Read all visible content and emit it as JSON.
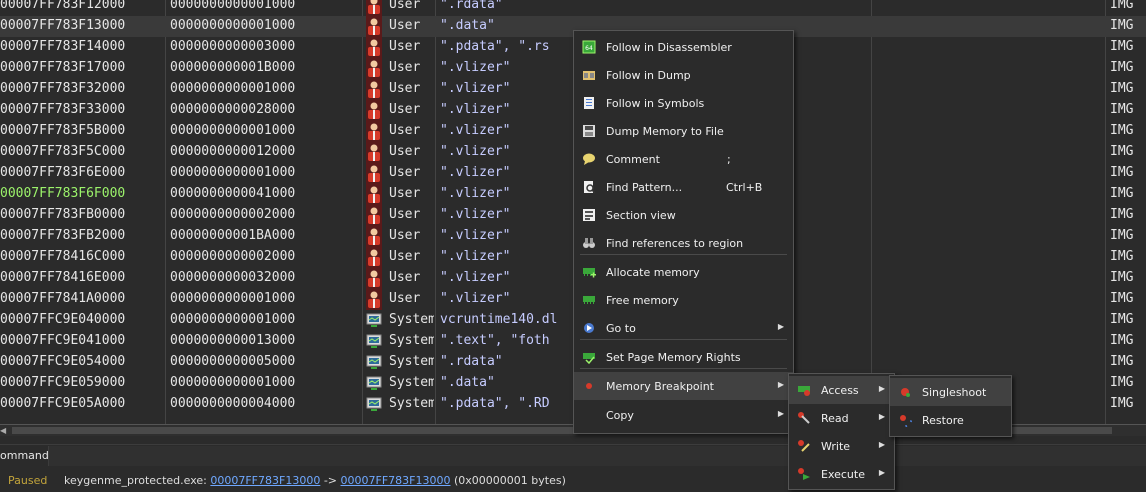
{
  "rows": [
    {
      "addr": "00007FF783F12000",
      "size": "0000000000001000",
      "type": "User",
      "info": "\".rdata\"",
      "prot": "IMG",
      "icon": "user-icon",
      "addr_color": "#e6e6e6",
      "selected": false
    },
    {
      "addr": "00007FF783F13000",
      "size": "0000000000001000",
      "type": "User",
      "info": "\".data\"",
      "prot": "IMG",
      "icon": "user-icon",
      "addr_color": "#e6e6e6",
      "selected": true
    },
    {
      "addr": "00007FF783F14000",
      "size": "0000000000003000",
      "type": "User",
      "info": "\".pdata\", \".rs",
      "prot": "IMG",
      "icon": "user-icon",
      "addr_color": "#e6e6e6",
      "selected": false
    },
    {
      "addr": "00007FF783F17000",
      "size": "000000000001B000",
      "type": "User",
      "info": "\".vlizer\"",
      "prot": "IMG",
      "icon": "user-icon",
      "addr_color": "#e6e6e6",
      "selected": false
    },
    {
      "addr": "00007FF783F32000",
      "size": "0000000000001000",
      "type": "User",
      "info": "\".vlizer\"",
      "prot": "IMG",
      "icon": "user-icon",
      "addr_color": "#e6e6e6",
      "selected": false
    },
    {
      "addr": "00007FF783F33000",
      "size": "0000000000028000",
      "type": "User",
      "info": "\".vlizer\"",
      "prot": "IMG",
      "icon": "user-icon",
      "addr_color": "#e6e6e6",
      "selected": false
    },
    {
      "addr": "00007FF783F5B000",
      "size": "0000000000001000",
      "type": "User",
      "info": "\".vlizer\"",
      "prot": "IMG",
      "icon": "user-icon",
      "addr_color": "#e6e6e6",
      "selected": false
    },
    {
      "addr": "00007FF783F5C000",
      "size": "0000000000012000",
      "type": "User",
      "info": "\".vlizer\"",
      "prot": "IMG",
      "icon": "user-icon",
      "addr_color": "#e6e6e6",
      "selected": false
    },
    {
      "addr": "00007FF783F6E000",
      "size": "0000000000001000",
      "type": "User",
      "info": "\".vlizer\"",
      "prot": "IMG",
      "icon": "user-icon",
      "addr_color": "#e6e6e6",
      "selected": false
    },
    {
      "addr": "00007FF783F6F000",
      "size": "0000000000041000",
      "type": "User",
      "info": "\".vlizer\"",
      "prot": "IMG",
      "icon": "user-icon",
      "addr_color": "#9cf36b",
      "selected": false
    },
    {
      "addr": "00007FF783FB0000",
      "size": "0000000000002000",
      "type": "User",
      "info": "\".vlizer\"",
      "prot": "IMG",
      "icon": "user-icon",
      "addr_color": "#e6e6e6",
      "selected": false
    },
    {
      "addr": "00007FF783FB2000",
      "size": "00000000001BA000",
      "type": "User",
      "info": "\".vlizer\"",
      "prot": "IMG",
      "icon": "user-icon",
      "addr_color": "#e6e6e6",
      "selected": false
    },
    {
      "addr": "00007FF78416C000",
      "size": "0000000000002000",
      "type": "User",
      "info": "\".vlizer\"",
      "prot": "IMG",
      "icon": "user-icon",
      "addr_color": "#e6e6e6",
      "selected": false
    },
    {
      "addr": "00007FF78416E000",
      "size": "0000000000032000",
      "type": "User",
      "info": "\".vlizer\"",
      "prot": "IMG",
      "icon": "user-icon",
      "addr_color": "#e6e6e6",
      "selected": false
    },
    {
      "addr": "00007FF7841A0000",
      "size": "0000000000001000",
      "type": "User",
      "info": "\".vlizer\"",
      "prot": "IMG",
      "icon": "user-icon",
      "addr_color": "#e6e6e6",
      "selected": false
    },
    {
      "addr": "00007FFC9E040000",
      "size": "0000000000001000",
      "type": "System",
      "info": "vcruntime140.dl",
      "prot": "IMG",
      "icon": "system-icon",
      "addr_color": "#e6e6e6",
      "selected": false
    },
    {
      "addr": "00007FFC9E041000",
      "size": "0000000000013000",
      "type": "System",
      "info": "\".text\", \"foth",
      "prot": "IMG",
      "icon": "system-icon",
      "addr_color": "#e6e6e6",
      "selected": false
    },
    {
      "addr": "00007FFC9E054000",
      "size": "0000000000005000",
      "type": "System",
      "info": "\".rdata\"",
      "prot": "IMG",
      "icon": "system-icon",
      "addr_color": "#e6e6e6",
      "selected": false
    },
    {
      "addr": "00007FFC9E059000",
      "size": "0000000000001000",
      "type": "System",
      "info": "\".data\"",
      "prot": "IMG",
      "icon": "system-icon",
      "addr_color": "#e6e6e6",
      "selected": false
    },
    {
      "addr": "00007FFC9E05A000",
      "size": "0000000000004000",
      "type": "System",
      "info": "\".pdata\", \".RD",
      "prot": "IMG",
      "icon": "system-icon",
      "addr_color": "#e6e6e6",
      "selected": false
    }
  ],
  "context_menu": [
    {
      "label": "Follow in Disassembler",
      "shortcut": "",
      "icon": "cpu-icon",
      "submenu": false,
      "highlight": false
    },
    {
      "label": "Follow in Dump",
      "shortcut": "",
      "icon": "dump-icon",
      "submenu": false,
      "highlight": false
    },
    {
      "label": "Follow in Symbols",
      "shortcut": "",
      "icon": "symbols-icon",
      "submenu": false,
      "highlight": false
    },
    {
      "label": "Dump Memory to File",
      "shortcut": "",
      "icon": "save-memory-icon",
      "submenu": false,
      "highlight": false
    },
    {
      "label": "Comment",
      "shortcut": ";",
      "icon": "comment-icon",
      "submenu": false,
      "highlight": false
    },
    {
      "label": "Find Pattern...",
      "shortcut": "Ctrl+B",
      "icon": "find-pattern-icon",
      "submenu": false,
      "highlight": false
    },
    {
      "label": "Section view",
      "shortcut": "",
      "icon": "section-view-icon",
      "submenu": false,
      "highlight": false
    },
    {
      "label": "Find references to region",
      "shortcut": "",
      "icon": "binoculars-icon",
      "submenu": false,
      "highlight": false
    },
    {
      "label": "Allocate memory",
      "shortcut": "",
      "icon": "allocate-memory-icon",
      "submenu": false,
      "highlight": false
    },
    {
      "label": "Free memory",
      "shortcut": "",
      "icon": "free-memory-icon",
      "submenu": false,
      "highlight": false
    },
    {
      "label": "Go to",
      "shortcut": "",
      "icon": "goto-icon",
      "submenu": true,
      "highlight": false
    },
    {
      "label": "Set Page Memory Rights",
      "shortcut": "",
      "icon": "memory-rights-icon",
      "submenu": false,
      "highlight": false
    },
    {
      "label": "Memory Breakpoint",
      "shortcut": "",
      "icon": "breakpoint-dot-icon",
      "submenu": true,
      "highlight": true
    },
    {
      "label": "Copy",
      "shortcut": "",
      "icon": "",
      "submenu": true,
      "highlight": false
    }
  ],
  "breakpoint_menu": [
    {
      "label": "Access",
      "icon": "access-icon",
      "highlight": true
    },
    {
      "label": "Read",
      "icon": "read-icon",
      "highlight": false
    },
    {
      "label": "Write",
      "icon": "write-icon",
      "highlight": false
    },
    {
      "label": "Execute",
      "icon": "execute-icon",
      "highlight": false
    }
  ],
  "access_menu": [
    {
      "label": "Singleshoot",
      "icon": "singleshoot-icon",
      "highlight": true
    },
    {
      "label": "Restore",
      "icon": "restore-icon",
      "highlight": false
    }
  ],
  "command": {
    "label": "ommand:",
    "value": ""
  },
  "status": {
    "state": "Paused",
    "message_prefix": "keygenme_protected.exe: ",
    "addr_from": "00007FF783F13000",
    "arrow": " -> ",
    "addr_to": "00007FF783F13000",
    "suffix": " (0x00000001 bytes)"
  },
  "colors": {
    "accent_addr": "#9cf36b",
    "info_text": "#c6ccff",
    "paused": "#c2a43b",
    "link": "#6fa8ff"
  }
}
